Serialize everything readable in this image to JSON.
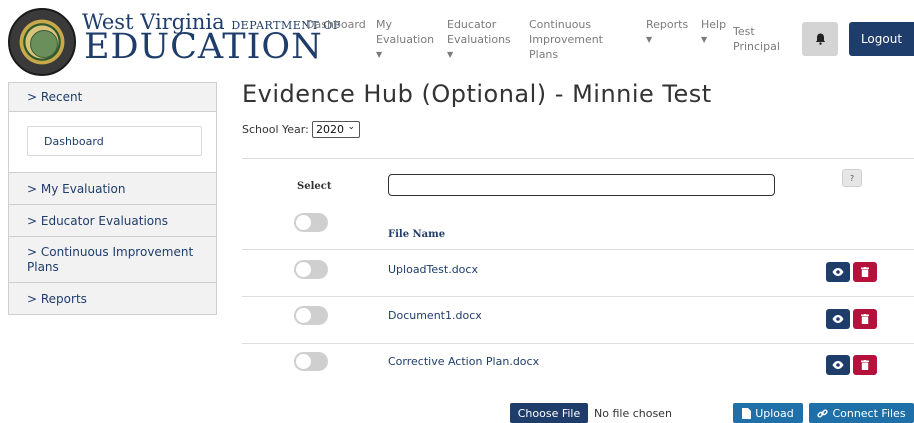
{
  "header": {
    "logo_line1": "West Virginia",
    "logo_dept": "DEPARTMENT OF",
    "logo_line2": "EDUCATION",
    "nav": [
      {
        "label": "Dashboard"
      },
      {
        "label": "My Evaluation"
      },
      {
        "label": "Educator Evaluations"
      },
      {
        "label": "Continuous Improvement Plans"
      },
      {
        "label": "Reports"
      },
      {
        "label": "Help"
      }
    ],
    "user_name": "Test Principal",
    "bell_icon": "bell-icon",
    "logout_label": "Logout"
  },
  "sidebar": {
    "recent_label": "> Recent",
    "dashboard_label": "Dashboard",
    "items": [
      {
        "label": "> My Evaluation"
      },
      {
        "label": "> Educator Evaluations"
      },
      {
        "label": "> Continuous Improvement Plans"
      },
      {
        "label": "> Reports"
      }
    ]
  },
  "main": {
    "title": "Evidence Hub (Optional) - Minnie Test",
    "school_year_label": "School Year:",
    "school_year_value": "2020",
    "select_header": "Select",
    "search_value": "",
    "help_label": "?",
    "file_name_header": "File Name",
    "files": [
      {
        "name": "UploadTest.docx",
        "selected": false
      },
      {
        "name": "Document1.docx",
        "selected": false
      },
      {
        "name": "Corrective Action Plan.docx",
        "selected": false
      }
    ],
    "choose_file_label": "Choose File",
    "no_file_text": "No file chosen",
    "upload_label": "Upload",
    "connect_label": "Connect Files"
  },
  "colors": {
    "brand_navy": "#1f3d6b",
    "delete_red": "#b5123b",
    "action_blue": "#1f6fa8"
  }
}
